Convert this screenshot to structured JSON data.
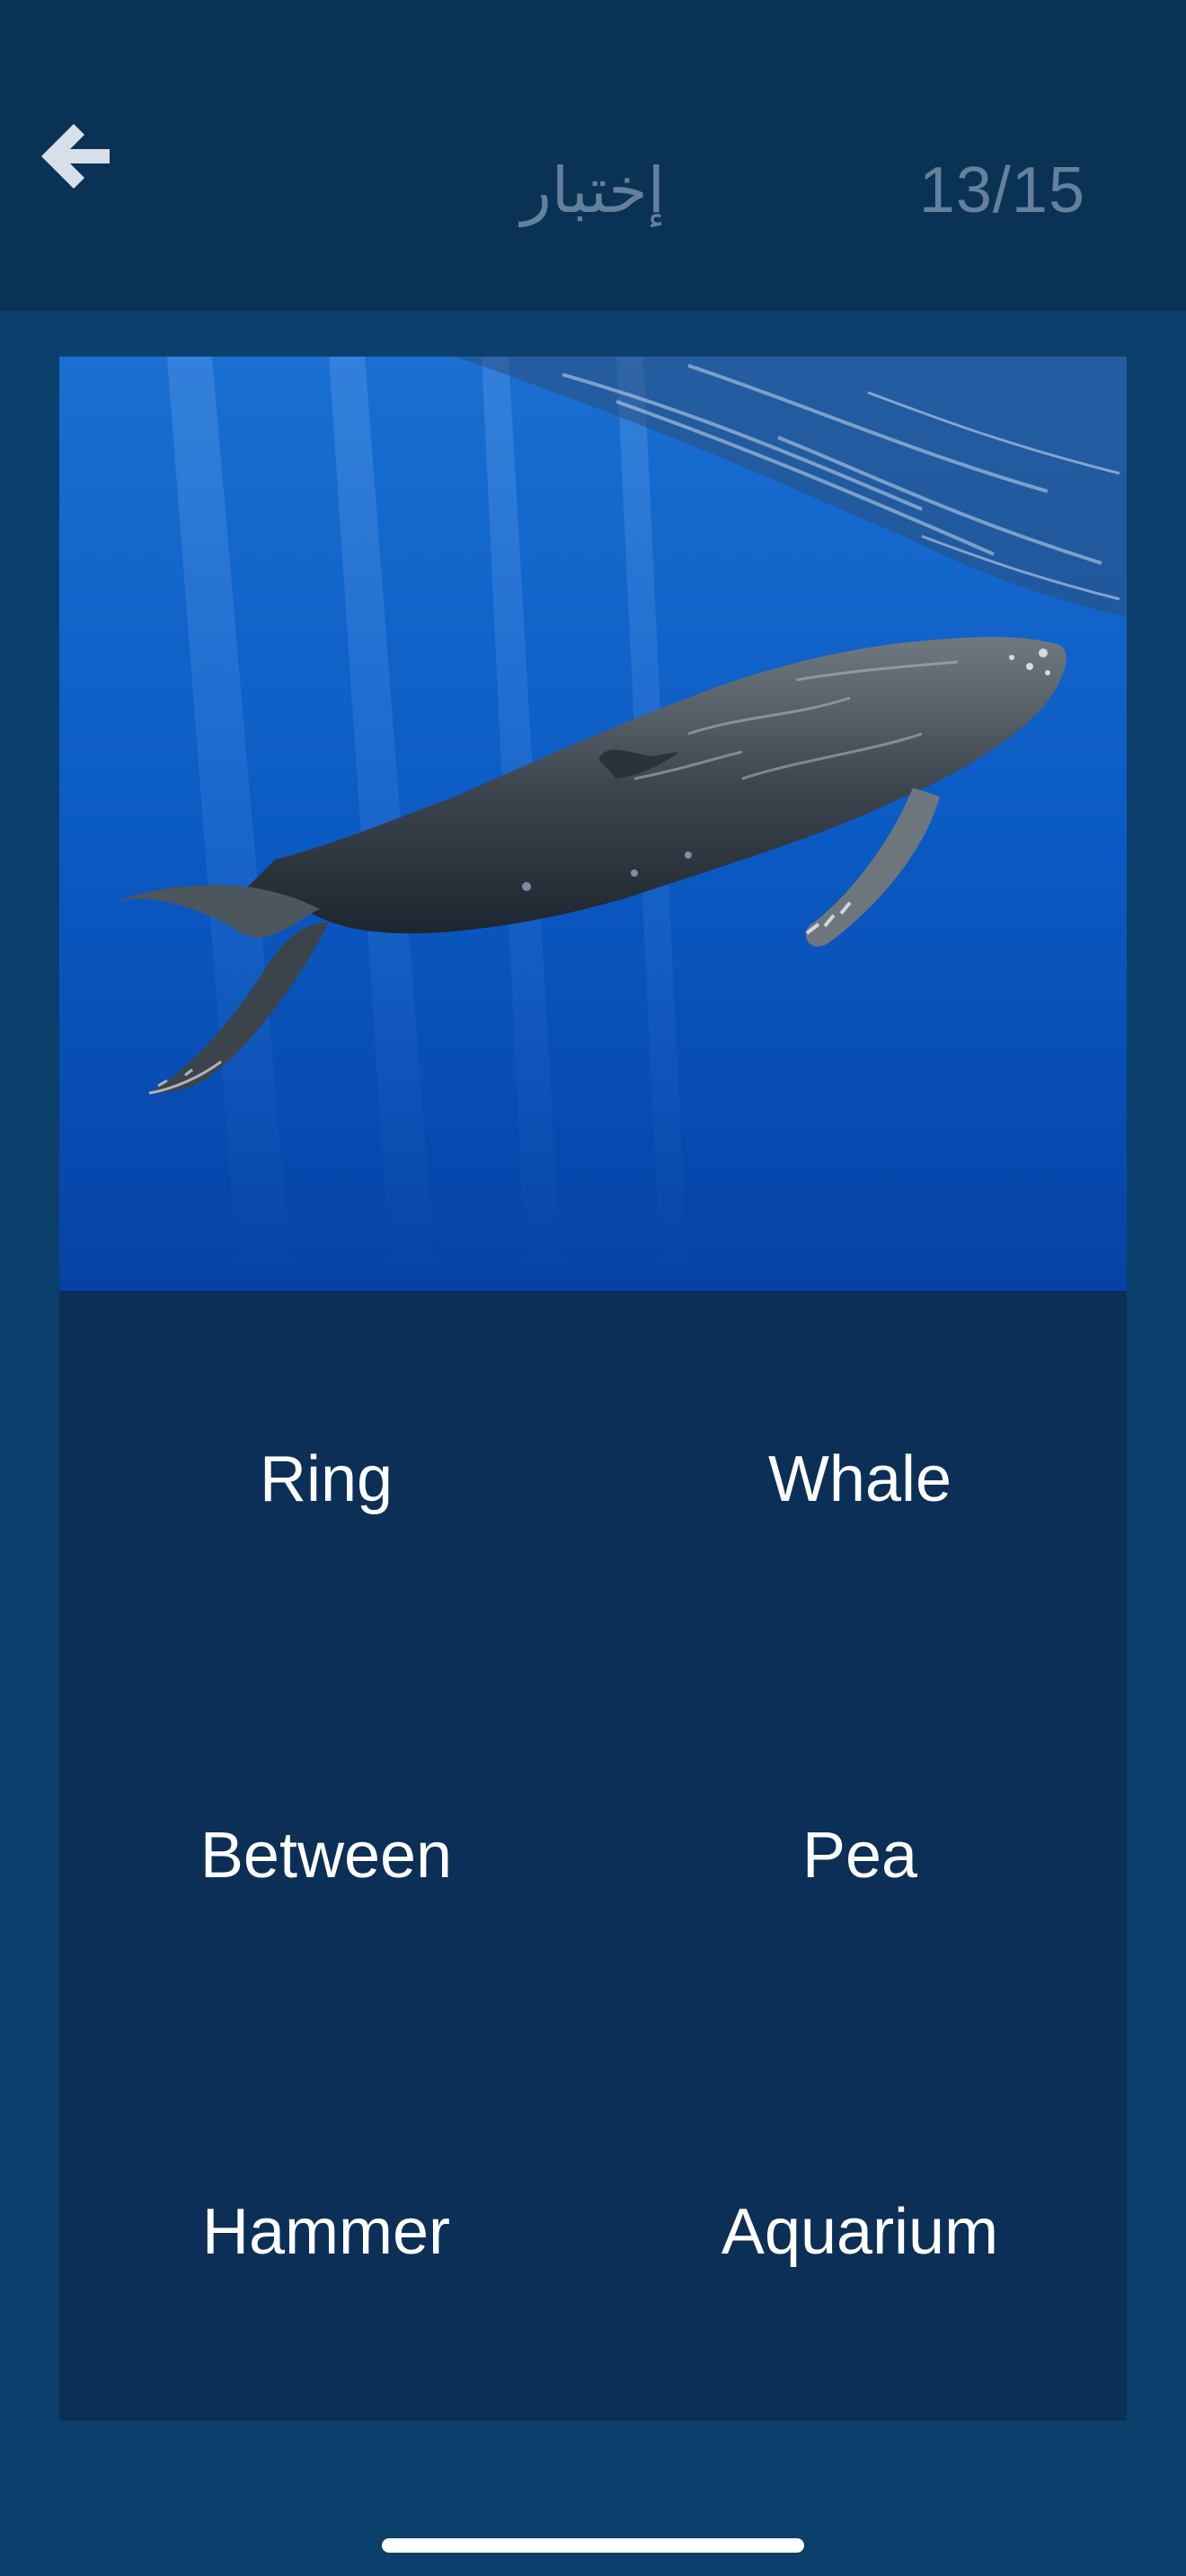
{
  "header": {
    "back_icon": "arrow-left-icon",
    "title": "إختبار",
    "progress": "13/15"
  },
  "question": {
    "image_subject": "humpback whale underwater"
  },
  "answers": [
    {
      "label": "Ring"
    },
    {
      "label": "Whale"
    },
    {
      "label": "Between"
    },
    {
      "label": "Pea"
    },
    {
      "label": "Hammer"
    },
    {
      "label": "Aquarium"
    }
  ],
  "colors": {
    "header_bg": "#0a3254",
    "page_bg": "#0b406c",
    "answers_bg": "#0b2f57",
    "muted_text": "#64809b",
    "answer_text": "#ffffff"
  }
}
